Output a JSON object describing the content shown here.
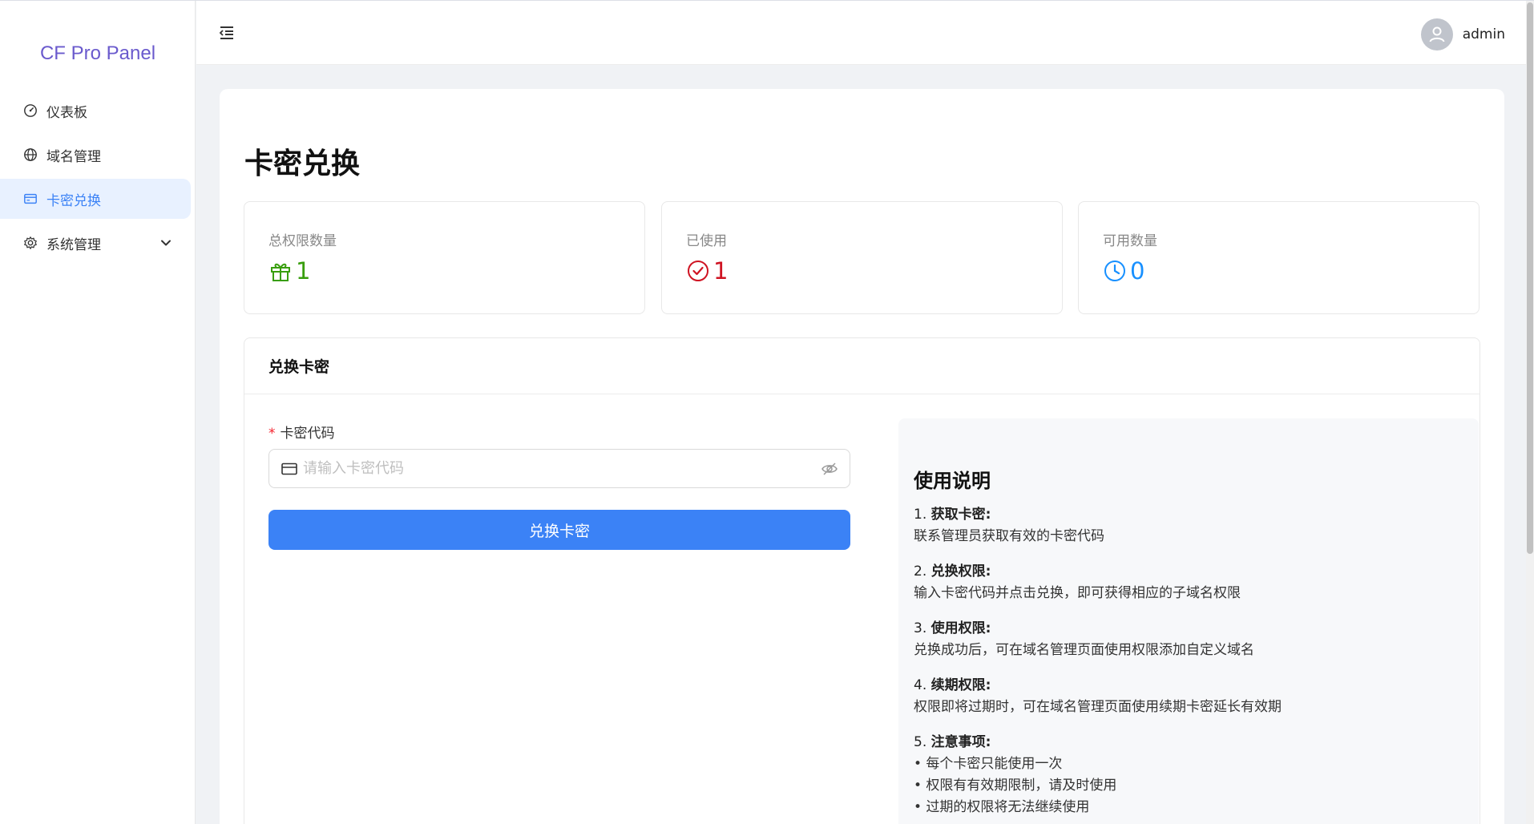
{
  "app": {
    "name": "CF Pro Panel"
  },
  "sidebar": {
    "items": [
      {
        "label": "仪表板",
        "icon": "dashboard-icon"
      },
      {
        "label": "域名管理",
        "icon": "globe-icon"
      },
      {
        "label": "卡密兑换",
        "icon": "card-icon",
        "active": true
      },
      {
        "label": "系统管理",
        "icon": "gear-icon",
        "expandable": true
      }
    ]
  },
  "header": {
    "username": "admin"
  },
  "page": {
    "title": "卡密兑换"
  },
  "stats": [
    {
      "label": "总权限数量",
      "value": "1",
      "icon": "gift-icon",
      "color": "#389e0d"
    },
    {
      "label": "已使用",
      "value": "1",
      "icon": "check-circle-icon",
      "color": "#cf1322"
    },
    {
      "label": "可用数量",
      "value": "0",
      "icon": "clock-icon",
      "color": "#1890ff"
    }
  ],
  "redeem": {
    "title": "兑换卡密",
    "field_label": "卡密代码",
    "required_mark": "*",
    "placeholder": "请输入卡密代码",
    "button": "兑换卡密"
  },
  "help": {
    "title": "使用说明",
    "sections": [
      {
        "num": "1.",
        "heading": "获取卡密:",
        "lines": [
          "联系管理员获取有效的卡密代码"
        ]
      },
      {
        "num": "2.",
        "heading": "兑换权限:",
        "lines": [
          "输入卡密代码并点击兑换，即可获得相应的子域名权限"
        ]
      },
      {
        "num": "3.",
        "heading": "使用权限:",
        "lines": [
          "兑换成功后，可在域名管理页面使用权限添加自定义域名"
        ]
      },
      {
        "num": "4.",
        "heading": "续期权限:",
        "lines": [
          "权限即将过期时，可在域名管理页面使用续期卡密延长有效期"
        ]
      },
      {
        "num": "5.",
        "heading": "注意事项:",
        "lines": [
          "• 每个卡密只能使用一次",
          "• 权限有有效期限制，请及时使用",
          "• 过期的权限将无法继续使用"
        ]
      }
    ]
  },
  "colors": {
    "primary": "#3b82f6",
    "logo": "#6a5acd"
  }
}
